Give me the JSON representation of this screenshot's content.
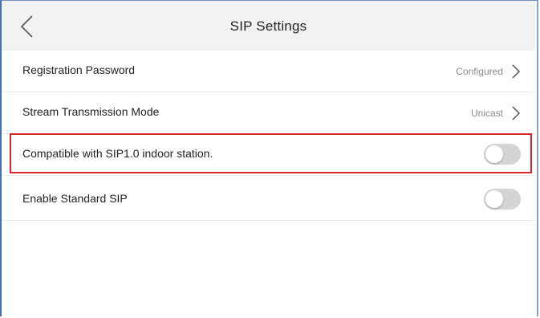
{
  "header": {
    "title": "SIP Settings",
    "back_icon": "chevron-left-icon"
  },
  "rows": [
    {
      "label": "Registration Password",
      "value": "Configured",
      "control": "chevron"
    },
    {
      "label": "Stream Transmission Mode",
      "value": "Unicast",
      "control": "chevron"
    },
    {
      "label": "Compatible with SIP1.0 indoor station.",
      "control": "toggle",
      "enabled": false,
      "highlighted": true
    },
    {
      "label": "Enable Standard SIP",
      "control": "toggle",
      "enabled": false
    }
  ],
  "colors": {
    "highlight_border": "#d9242b",
    "toggle_off": "#d4d4d4",
    "header_bg": "#f2f2f2"
  }
}
